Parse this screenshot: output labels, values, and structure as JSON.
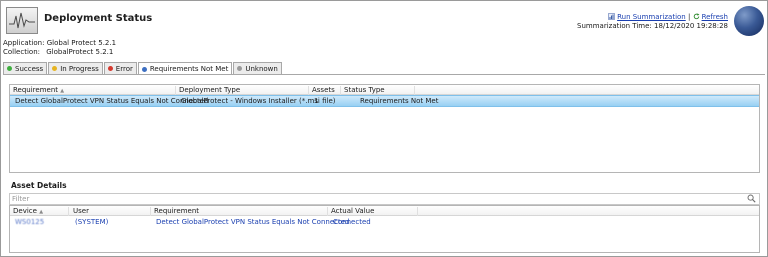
{
  "window": {
    "title": "Deployment Status"
  },
  "header": {
    "run_summarization": "Run Summarization",
    "separator": "|",
    "refresh": "Refresh",
    "summarization_label": "Summarization Time:",
    "summarization_time": "18/12/2020 19:28:28"
  },
  "meta": {
    "application_label": "Application:",
    "application_value": "Global Protect 5.2.1",
    "collection_label": "Collection:",
    "collection_value": "GlobalProtect 5.2.1"
  },
  "tabs": [
    {
      "label": "Success",
      "color": "#3fae3f"
    },
    {
      "label": "In Progress",
      "color": "#e6b422"
    },
    {
      "label": "Error",
      "color": "#d43a2f"
    },
    {
      "label": "Requirements Not Met",
      "color": "#3d6fc2",
      "active": true
    },
    {
      "label": "Unknown",
      "color": "#9a9a9a"
    }
  ],
  "requirements_grid": {
    "columns": [
      "Requirement",
      "Deployment Type",
      "Assets",
      "Status Type"
    ],
    "rows": [
      {
        "requirement": "Detect GlobalProtect VPN Status Equals Not Connected",
        "deployment_type": "GlobalProtect - Windows Installer (*.msi file)",
        "assets": "1",
        "status_type": "Requirements Not Met"
      }
    ]
  },
  "asset_details": {
    "title": "Asset Details",
    "filter_placeholder": "Filter",
    "columns": [
      "Device",
      "User",
      "Requirement",
      "Actual Value"
    ],
    "rows": [
      {
        "device": "WS0125",
        "user": "(SYSTEM)",
        "requirement": "Detect GlobalProtect VPN Status Equals Not Connected",
        "actual_value": "Connected"
      }
    ]
  },
  "icons": {
    "app": "chart-monitor-icon",
    "run": "run-summarization-icon",
    "refresh": "refresh-icon",
    "orb": "config-manager-orb-icon",
    "search": "magnifier-icon",
    "sort": "sort-ascending-icon"
  },
  "colors": {
    "selection": "#98d0f3",
    "link": "#1a3fb0"
  }
}
